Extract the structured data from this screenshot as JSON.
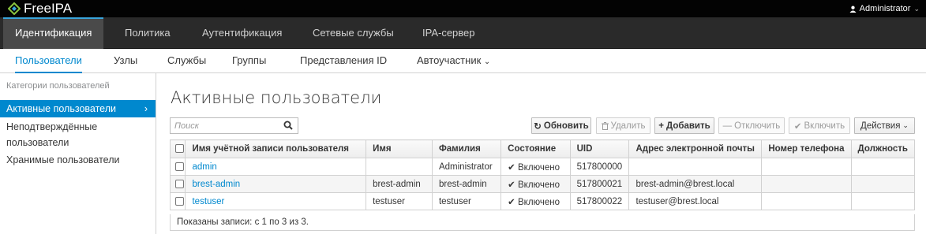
{
  "topbar": {
    "brand": "FreeIPA",
    "user": "Administrator"
  },
  "nav1": [
    "Идентификация",
    "Политика",
    "Аутентификация",
    "Сетевые службы",
    "IPA-сервер"
  ],
  "nav2": [
    "Пользователи",
    "Узлы",
    "Службы",
    "Группы",
    "Представления ID",
    "Автоучастник"
  ],
  "sidebar": {
    "header": "Категории пользователей",
    "items": [
      "Активные пользователи",
      "Неподтверждённые пользователи",
      "Хранимые пользователи"
    ]
  },
  "main": {
    "title": "Активные пользователи",
    "search_placeholder": "Поиск",
    "buttons": {
      "refresh": "Обновить",
      "delete": "Удалить",
      "add": "Добавить",
      "disable": "Отключить",
      "enable": "Включить",
      "actions": "Действия"
    }
  },
  "table": {
    "columns": [
      "Имя учётной записи пользователя",
      "Имя",
      "Фамилия",
      "Состояние",
      "UID",
      "Адрес электронной почты",
      "Номер телефона",
      "Должность"
    ],
    "rows": [
      {
        "login": "admin",
        "first": "",
        "last": "Administrator",
        "status": "Включено",
        "uid": "517800000",
        "email": "",
        "phone": "",
        "title": ""
      },
      {
        "login": "brest-admin",
        "first": "brest-admin",
        "last": "brest-admin",
        "status": "Включено",
        "uid": "517800021",
        "email": "brest-admin@brest.local",
        "phone": "",
        "title": ""
      },
      {
        "login": "testuser",
        "first": "testuser",
        "last": "testuser",
        "status": "Включено",
        "uid": "517800022",
        "email": "testuser@brest.local",
        "phone": "",
        "title": ""
      }
    ],
    "footer": "Показаны записи: с 1 по 3 из 3."
  },
  "colors": {
    "accent": "#0088ce",
    "topbar": "#030303",
    "nav1": "#2a2a2a",
    "nav1_active": "#4a4a4a"
  },
  "icons": {
    "brand": "freeipa-logo-icon",
    "user": "user-icon",
    "refresh": "refresh-icon",
    "delete": "trash-icon",
    "add": "plus-icon",
    "disable": "minus-icon",
    "enable": "check-icon",
    "search": "search-icon"
  }
}
